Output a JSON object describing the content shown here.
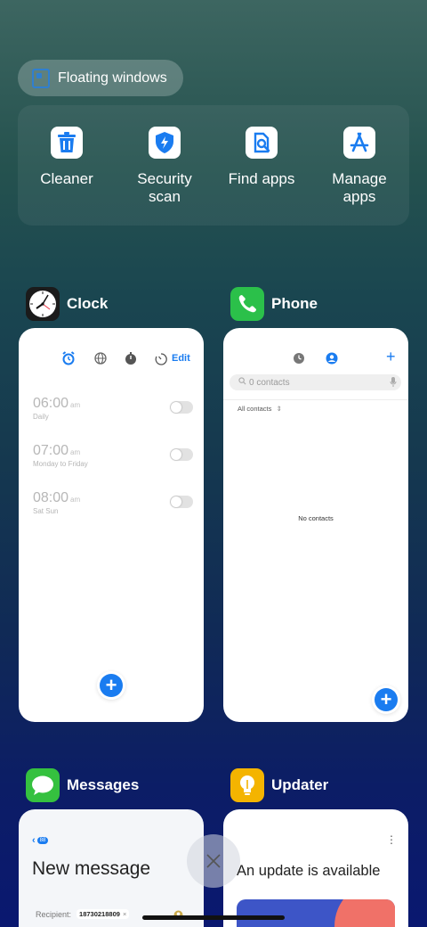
{
  "floating_windows": {
    "label": "Floating windows"
  },
  "tools": [
    {
      "label": "Cleaner",
      "icon": "trash-icon"
    },
    {
      "label": "Security\nscan",
      "icon": "shield-bolt-icon"
    },
    {
      "label": "Find apps",
      "icon": "search-doc-icon"
    },
    {
      "label": "Manage\napps",
      "icon": "app-store-icon"
    }
  ],
  "apps": {
    "clock": {
      "name": "Clock",
      "edit_label": "Edit",
      "alarms": [
        {
          "time": "06:00",
          "ampm": "am",
          "repeat": "Daily"
        },
        {
          "time": "07:00",
          "ampm": "am",
          "repeat": "Monday to Friday"
        },
        {
          "time": "08:00",
          "ampm": "am",
          "repeat": "Sat Sun"
        }
      ]
    },
    "phone": {
      "name": "Phone",
      "search_placeholder": "0 contacts",
      "filter_label": "All contacts",
      "empty_text": "No contacts"
    },
    "messages": {
      "name": "Messages",
      "back_badge": "88",
      "title": "New message",
      "recipient_label": "Recipient:",
      "recipient_number": "18730218809"
    },
    "updater": {
      "name": "Updater",
      "title": "An update is available"
    }
  },
  "colors": {
    "accent": "#1a7cf0",
    "phone_green": "#2bc04a",
    "messages_green": "#35c13f",
    "updater_yellow": "#f4b400"
  }
}
